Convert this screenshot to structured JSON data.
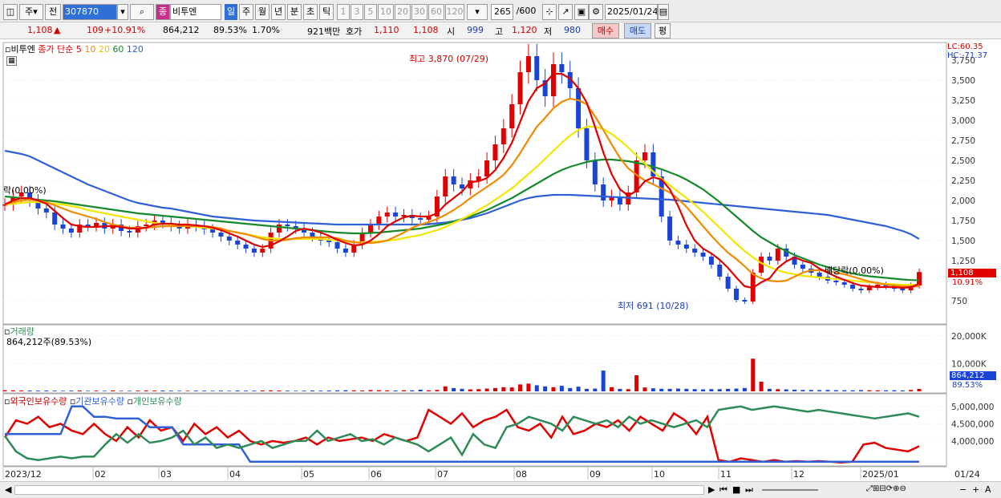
{
  "toolbar": {
    "day_label": "주",
    "prev_label": "전",
    "code": "307870",
    "period_sel": "일",
    "periods": [
      "주",
      "월",
      "년",
      "분",
      "초",
      "틱"
    ],
    "ticks": [
      "1",
      "3",
      "5",
      "10",
      "20",
      "30",
      "60",
      "120"
    ],
    "count": "265",
    "total": "/600",
    "date": "2025/01/24"
  },
  "stock": {
    "name": "비투엔",
    "price": "1,108",
    "change": "109",
    "change_pct": "+10.91%",
    "volume": "864,212",
    "vol_ratio": "89.53%",
    "turnover": "1.70%",
    "amount": "921백만",
    "quote_label": "호가",
    "ask": "1,110",
    "bid": "1,108",
    "open_label": "시",
    "open": "999",
    "high_label": "고",
    "high": "1,120",
    "low_label": "저",
    "low": "980",
    "buy_label": "매수",
    "sell_label": "매도",
    "eval_label": "평"
  },
  "legend": {
    "name": "비투엔",
    "ma_label": "종가 단순",
    "ma": [
      "5",
      "10",
      "20",
      "60",
      "120"
    ]
  },
  "annotations": {
    "high": "최고 3,870 (07/29)",
    "low": "최저 691 (10/28)",
    "dividend_right": "배당락(0.00%)",
    "dividend_left": "락(0.00%)",
    "lc": "LC:60.35",
    "hc": "HC:-71.37",
    "price_tag": "1,108",
    "pct_tag": "10.91%",
    "vol_tag": "864,212",
    "vol_pct_tag": "89.53%"
  },
  "volume_panel": {
    "title": "거래량",
    "value": "864,212주(89.53%)"
  },
  "holdings_panel": {
    "series": [
      "외국인보유수량",
      "기관보유수량",
      "개인보유수량"
    ]
  },
  "xaxis": {
    "labels": [
      "2023/12",
      "02",
      "03",
      "04",
      "05",
      "06",
      "07",
      "08",
      "09",
      "10",
      "11",
      "12",
      "2025/01",
      "01/24"
    ]
  },
  "colors": {
    "up": "#e00000",
    "down": "#1a44d6",
    "ma5": "#e00000",
    "ma10": "#f08a00",
    "ma20": "#f2e600",
    "ma60": "#168a2a",
    "ma120": "#3060d8",
    "foreign": "#e00000",
    "inst": "#3060d8",
    "indiv": "#2e8b57"
  },
  "chart_data": [
    {
      "type": "candlestick",
      "title": "비투엔",
      "ylim": [
        500,
        3900
      ],
      "y_ticks": [
        750,
        1000,
        1250,
        1500,
        1750,
        2000,
        2250,
        2500,
        2750,
        3000,
        3250,
        3500,
        3750
      ],
      "y_tick_labels": [
        "750",
        "",
        "1,250",
        "1,500",
        "1,750",
        "2,000",
        "2,250",
        "2,500",
        "2,750",
        "3,000",
        "3,250",
        "3,500",
        "3,750"
      ],
      "close": [
        1950,
        2050,
        2100,
        2000,
        1900,
        1850,
        1700,
        1650,
        1600,
        1700,
        1680,
        1720,
        1650,
        1700,
        1620,
        1600,
        1680,
        1700,
        1750,
        1720,
        1680,
        1650,
        1700,
        1680,
        1640,
        1600,
        1550,
        1500,
        1450,
        1400,
        1350,
        1400,
        1600,
        1700,
        1680,
        1650,
        1600,
        1550,
        1500,
        1480,
        1400,
        1350,
        1450,
        1600,
        1700,
        1800,
        1850,
        1800,
        1820,
        1780,
        1760,
        1800,
        2050,
        2300,
        2200,
        2150,
        2250,
        2300,
        2500,
        2700,
        2900,
        3200,
        3600,
        3800,
        3500,
        3300,
        3700,
        3600,
        3400,
        2900,
        2500,
        2200,
        2000,
        2050,
        1950,
        2100,
        2500,
        2600,
        2300,
        1800,
        1500,
        1450,
        1400,
        1350,
        1300,
        1200,
        1050,
        900,
        760,
        740,
        1100,
        1300,
        1250,
        1400,
        1300,
        1200,
        1150,
        1100,
        1050,
        1000,
        980,
        950,
        900,
        880,
        920,
        950,
        930,
        900,
        880,
        940,
        1108
      ],
      "ma5": [
        1950,
        2000,
        2030,
        2030,
        2000,
        1960,
        1870,
        1780,
        1700,
        1680,
        1670,
        1670,
        1680,
        1680,
        1670,
        1650,
        1650,
        1660,
        1700,
        1710,
        1710,
        1700,
        1700,
        1690,
        1680,
        1660,
        1630,
        1590,
        1550,
        1500,
        1450,
        1420,
        1440,
        1490,
        1550,
        1620,
        1650,
        1630,
        1600,
        1560,
        1510,
        1470,
        1440,
        1450,
        1500,
        1580,
        1680,
        1740,
        1790,
        1810,
        1800,
        1800,
        1840,
        1950,
        2030,
        2110,
        2230,
        2240,
        2280,
        2380,
        2530,
        2720,
        2980,
        3240,
        3400,
        3460,
        3580,
        3580,
        3520,
        3400,
        3220,
        2920,
        2600,
        2330,
        2140,
        2060,
        2120,
        2240,
        2290,
        2260,
        2140,
        1930,
        1690,
        1500,
        1400,
        1340,
        1260,
        1160,
        1040,
        930,
        910,
        980,
        1030,
        1160,
        1240,
        1290,
        1250,
        1220,
        1150,
        1100,
        1050,
        1010,
        970,
        940,
        930,
        920,
        920,
        920,
        910,
        920,
        960
      ],
      "ma10": [
        1950,
        1980,
        2000,
        2010,
        2000,
        1980,
        1940,
        1900,
        1860,
        1830,
        1800,
        1770,
        1730,
        1700,
        1680,
        1660,
        1660,
        1660,
        1670,
        1680,
        1680,
        1680,
        1680,
        1680,
        1680,
        1670,
        1650,
        1620,
        1600,
        1580,
        1550,
        1520,
        1500,
        1500,
        1510,
        1530,
        1540,
        1540,
        1540,
        1540,
        1530,
        1500,
        1480,
        1470,
        1470,
        1480,
        1500,
        1550,
        1600,
        1660,
        1700,
        1730,
        1770,
        1820,
        1880,
        1950,
        2030,
        2100,
        2170,
        2240,
        2320,
        2440,
        2590,
        2760,
        2920,
        3030,
        3150,
        3230,
        3270,
        3250,
        3200,
        3050,
        2880,
        2700,
        2530,
        2400,
        2320,
        2250,
        2200,
        2150,
        2100,
        2020,
        1920,
        1800,
        1680,
        1560,
        1450,
        1350,
        1270,
        1180,
        1080,
        1030,
        1000,
        990,
        1000,
        1050,
        1100,
        1130,
        1130,
        1120,
        1100,
        1080,
        1050,
        1020,
        990,
        970,
        950,
        940,
        930,
        925,
        930
      ],
      "ma20": [
        1950,
        1960,
        1970,
        1980,
        1980,
        1970,
        1960,
        1950,
        1930,
        1910,
        1880,
        1860,
        1840,
        1820,
        1800,
        1780,
        1760,
        1740,
        1720,
        1710,
        1700,
        1690,
        1680,
        1670,
        1660,
        1650,
        1640,
        1620,
        1600,
        1580,
        1560,
        1540,
        1530,
        1520,
        1520,
        1520,
        1520,
        1520,
        1520,
        1510,
        1500,
        1490,
        1480,
        1480,
        1480,
        1490,
        1500,
        1510,
        1530,
        1550,
        1570,
        1600,
        1630,
        1670,
        1720,
        1770,
        1820,
        1880,
        1940,
        2010,
        2080,
        2150,
        2240,
        2330,
        2420,
        2520,
        2620,
        2720,
        2810,
        2880,
        2920,
        2920,
        2890,
        2830,
        2750,
        2660,
        2560,
        2460,
        2360,
        2270,
        2190,
        2110,
        2030,
        1950,
        1860,
        1760,
        1660,
        1560,
        1460,
        1370,
        1290,
        1220,
        1170,
        1130,
        1100,
        1080,
        1060,
        1050,
        1040,
        1030,
        1020,
        1010,
        1000,
        990,
        980,
        970,
        960,
        955,
        950,
        948,
        950
      ],
      "ma60": [
        2050,
        2040,
        2030,
        2020,
        2010,
        2000,
        1990,
        1975,
        1960,
        1945,
        1930,
        1915,
        1900,
        1885,
        1870,
        1855,
        1840,
        1830,
        1820,
        1810,
        1800,
        1790,
        1780,
        1770,
        1760,
        1750,
        1740,
        1730,
        1720,
        1710,
        1700,
        1690,
        1680,
        1670,
        1660,
        1650,
        1640,
        1630,
        1620,
        1610,
        1600,
        1595,
        1590,
        1590,
        1595,
        1600,
        1610,
        1620,
        1630,
        1640,
        1650,
        1670,
        1690,
        1710,
        1740,
        1770,
        1800,
        1840,
        1880,
        1930,
        1980,
        2030,
        2090,
        2150,
        2210,
        2270,
        2330,
        2380,
        2420,
        2450,
        2480,
        2500,
        2510,
        2510,
        2500,
        2490,
        2470,
        2450,
        2420,
        2390,
        2350,
        2310,
        2260,
        2200,
        2140,
        2060,
        1980,
        1890,
        1800,
        1710,
        1620,
        1540,
        1480,
        1420,
        1370,
        1320,
        1280,
        1240,
        1200,
        1170,
        1140,
        1110,
        1090,
        1070,
        1055,
        1045,
        1035,
        1025,
        1015,
        1008,
        1005
      ],
      "ma120": [
        2620,
        2600,
        2580,
        2550,
        2500,
        2450,
        2400,
        2350,
        2300,
        2250,
        2200,
        2160,
        2120,
        2080,
        2040,
        2000,
        1970,
        1950,
        1930,
        1910,
        1900,
        1880,
        1860,
        1840,
        1820,
        1800,
        1790,
        1780,
        1770,
        1760,
        1750,
        1745,
        1740,
        1735,
        1730,
        1725,
        1720,
        1715,
        1710,
        1705,
        1700,
        1700,
        1700,
        1700,
        1700,
        1700,
        1700,
        1700,
        1700,
        1700,
        1700,
        1705,
        1715,
        1725,
        1740,
        1760,
        1780,
        1810,
        1840,
        1880,
        1920,
        1960,
        2000,
        2030,
        2050,
        2060,
        2070,
        2070,
        2070,
        2065,
        2060,
        2055,
        2050,
        2045,
        2040,
        2035,
        2030,
        2025,
        2020,
        2015,
        2010,
        2000,
        1990,
        1980,
        1970,
        1960,
        1950,
        1940,
        1930,
        1920,
        1910,
        1900,
        1890,
        1880,
        1870,
        1860,
        1850,
        1840,
        1830,
        1820,
        1800,
        1780,
        1760,
        1740,
        1720,
        1700,
        1680,
        1650,
        1620,
        1580,
        1520
      ]
    },
    {
      "type": "bar",
      "title": "거래량",
      "ylim": [
        0,
        22000
      ],
      "y_ticks": [
        10000,
        20000
      ],
      "y_tick_labels": [
        "10,000K",
        "20,000K"
      ],
      "values": [
        400,
        350,
        300,
        300,
        250,
        300,
        250,
        200,
        250,
        300,
        200,
        250,
        200,
        300,
        200,
        200,
        250,
        300,
        250,
        300,
        250,
        200,
        200,
        250,
        250,
        200,
        250,
        200,
        300,
        250,
        250,
        300,
        350,
        300,
        250,
        200,
        250,
        300,
        250,
        300,
        350,
        400,
        350,
        300,
        450,
        400,
        350,
        300,
        400,
        350,
        600,
        350,
        500,
        1800,
        1200,
        900,
        700,
        800,
        1000,
        1200,
        1500,
        1400,
        2500,
        2800,
        2200,
        1800,
        1500,
        2000,
        1200,
        1700,
        900,
        1000,
        7500,
        1500,
        900,
        800,
        5800,
        1400,
        1100,
        900,
        900,
        1000,
        900,
        800,
        700,
        800,
        800,
        900,
        1000,
        1200,
        11800,
        3500,
        900,
        800,
        700,
        600,
        500,
        500,
        450,
        500,
        400,
        400,
        350,
        450,
        400,
        350,
        350,
        400,
        350,
        500,
        864
      ]
    },
    {
      "type": "line",
      "title": "보유수량",
      "ylim": [
        3350000,
        5250000
      ],
      "y_ticks": [
        4000000,
        4500000,
        5000000
      ],
      "y_tick_labels": [
        "4,000,000",
        "4,500,000",
        "5,000,000"
      ],
      "series": [
        {
          "name": "외국인보유수량",
          "values": [
            4100000,
            4600000,
            4500000,
            4700000,
            4400000,
            4500000,
            4300000,
            4200000,
            4500000,
            4200000,
            4000000,
            4400000,
            4100000,
            4600000,
            4300000,
            4400000,
            4000000,
            4500000,
            4200000,
            4400000,
            4100000,
            4300000,
            4000000,
            3900000,
            4000000,
            3950000,
            4000000,
            4100000,
            3900000,
            4100000,
            4000000,
            4050000,
            4100000,
            4000000,
            4200000,
            4100000,
            4000000,
            4100000,
            4900000,
            4700000,
            4500000,
            4800000,
            4400000,
            4600000,
            4700000,
            4900000,
            4400000,
            4300000,
            4500000,
            4100000,
            4700000,
            4200000,
            4300000,
            4500000,
            4400000,
            4600000,
            4300000,
            4700000,
            4500000,
            4300000,
            4800000,
            4600000,
            4200000,
            4700000,
            3450000,
            3400000,
            3500000,
            3450000,
            3400000,
            3450000,
            3400000,
            3420000,
            3400000,
            3420000,
            3400000,
            3380000,
            3400000,
            3900000,
            3950000,
            3800000,
            3750000,
            3700000,
            3850000
          ]
        },
        {
          "name": "기관보유수량",
          "values": [
            4200000,
            4200000,
            4200000,
            4200000,
            4200000,
            4200000,
            5000000,
            5000000,
            4700000,
            4700000,
            4650000,
            4650000,
            4650000,
            4400000,
            4400000,
            4400000,
            3900000,
            3900000,
            3900000,
            3900000,
            3900000,
            3900000,
            3400000,
            3400000,
            3400000,
            3400000,
            3400000,
            3400000,
            3400000,
            3400000,
            3400000,
            3400000,
            3400000,
            3400000,
            3400000,
            3400000,
            3400000,
            3400000,
            3400000,
            3400000,
            3400000,
            3400000,
            3400000,
            3400000,
            3400000,
            3400000,
            3400000,
            3400000,
            3400000,
            3400000,
            3400000,
            3400000,
            3400000,
            3400000,
            3400000,
            3400000,
            3400000,
            3400000,
            3400000,
            3400000,
            3400000,
            3400000,
            3400000,
            3400000,
            3400000,
            3400000,
            3400000,
            3400000,
            3400000,
            3400000,
            3400000,
            3400000,
            3400000,
            3400000,
            3400000,
            3400000,
            3400000,
            3400000,
            3400000,
            3400000,
            3400000,
            3400000,
            3400000
          ]
        },
        {
          "name": "개인보유수량",
          "values": [
            4150000,
            3700000,
            3500000,
            3450000,
            3500000,
            3550000,
            3500000,
            3550000,
            3550000,
            3900000,
            4200000,
            3950000,
            4200000,
            3950000,
            4000000,
            4100000,
            4300000,
            3900000,
            4100000,
            3800000,
            3900000,
            3800000,
            3900000,
            4000000,
            3800000,
            3900000,
            4000000,
            4000000,
            4300000,
            4000000,
            4100000,
            4200000,
            4000000,
            4050000,
            3900000,
            4100000,
            4000000,
            3900000,
            3700000,
            3900000,
            4100000,
            3600000,
            4200000,
            3900000,
            3800000,
            4400000,
            4500000,
            4700000,
            4600000,
            4500000,
            4300000,
            4700000,
            4600000,
            4500000,
            4600000,
            4400000,
            4700000,
            4500000,
            4600000,
            4500000,
            4400000,
            4500000,
            4600000,
            4400000,
            4900000,
            4950000,
            5000000,
            4900000,
            4950000,
            5000000,
            4950000,
            4900000,
            4850000,
            4900000,
            4850000,
            4800000,
            4750000,
            4700000,
            4650000,
            4700000,
            4750000,
            4800000,
            4700000
          ]
        }
      ]
    }
  ]
}
